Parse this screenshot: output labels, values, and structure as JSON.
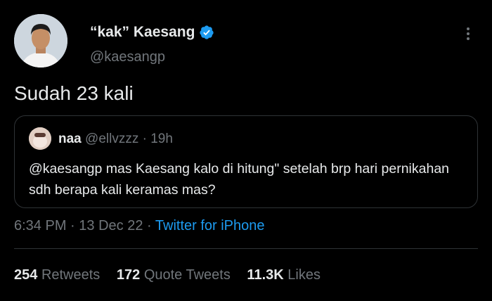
{
  "author": {
    "display_name": "“kak” Kaesang",
    "handle": "@kaesangp",
    "verified_color": "#1d9bf0"
  },
  "tweet": {
    "text": "Sudah 23 kali"
  },
  "quoted": {
    "name": "naa",
    "handle": "@ellvzzz",
    "separator": "·",
    "time": "19h",
    "text": "@kaesangp mas Kaesang kalo di hitung\" setelah brp hari pernikahan sdh berapa kali keramas mas?"
  },
  "meta": {
    "time": "6:34 PM",
    "sep1": "·",
    "date": "13 Dec 22",
    "sep2": "·",
    "source": "Twitter for iPhone"
  },
  "stats": {
    "retweets_count": "254",
    "retweets_label": "Retweets",
    "quotes_count": "172",
    "quotes_label": "Quote Tweets",
    "likes_count": "11.3K",
    "likes_label": "Likes"
  }
}
